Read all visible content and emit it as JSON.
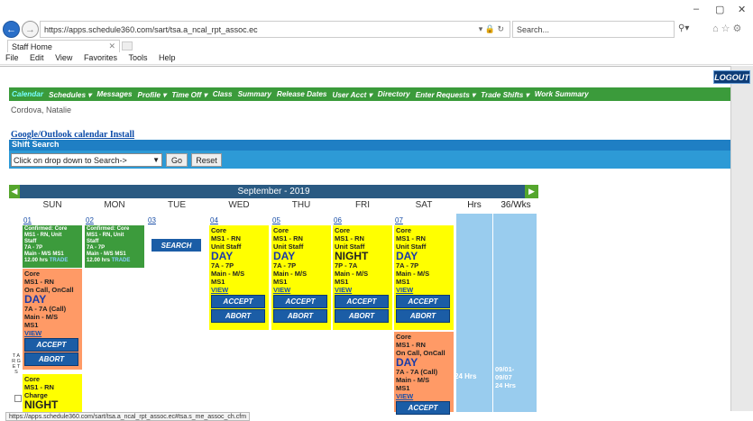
{
  "browser": {
    "url": "https://apps.schedule360.com/sart/tsa.a_ncal_rpt_assoc.ec",
    "search_placeholder": "Search...",
    "tab_title": "Staff Home",
    "menu": [
      "File",
      "Edit",
      "View",
      "Favorites",
      "Tools",
      "Help"
    ],
    "status_url": "https://apps.schedule360.com/sart/tsa.a_ncal_rpt_assoc.ec#tsa.s_me_assoc_ch.cfm",
    "window_controls": [
      "–",
      "▢",
      "✕"
    ]
  },
  "app": {
    "logout_label": "LOGOUT",
    "nav": [
      "Calendar",
      "Schedules ▾",
      "Messages",
      "Profile ▾",
      "Time Off ▾",
      "Class",
      "Summary",
      "Release Dates",
      "User Acct ▾",
      "Directory",
      "Enter Requests ▾",
      "Trade Shifts ▾",
      "Work Summary"
    ],
    "user_name": "Cordova, Natalie",
    "google_link": "Google/Outlook calendar Install",
    "shift_search_title": "Shift Search",
    "dropdown_value": "Click on drop down to Search->",
    "go_label": "Go",
    "reset_label": "Reset",
    "month_title": "September - 2019",
    "search_button": "SEARCH",
    "colors": {
      "nav_green": "#3b9b3b",
      "shift_blue": "#1f7fc4",
      "month_bar": "#2a5a82",
      "card_yellow": "#ffff00",
      "card_orange": "#ff9a66",
      "card_green": "#3c9b3c",
      "hrs_col": "#99ccee"
    }
  },
  "calendar": {
    "day_headers": [
      "SUN",
      "MON",
      "TUE",
      "WED",
      "THU",
      "FRI",
      "SAT",
      "Hrs",
      "36/Wks"
    ],
    "dates": [
      "01",
      "02",
      "03",
      "04",
      "05",
      "06",
      "07"
    ],
    "sun_green": {
      "l1": "Confirmed: Core",
      "l2": "MS1 - RN, Unit",
      "l3": "Staff",
      "l4": "7A - 7P",
      "l5": "Main - M/S MS1",
      "l6": "12.00 hrs",
      "l7": "TRADE"
    },
    "mon_green": {
      "l1": "Confirmed: Core",
      "l2": "MS1 - RN, Unit",
      "l3": "Staff",
      "l4": "7A - 7P",
      "l5": "Main - M/S MS1",
      "l6": "12.00 hrs",
      "l7": "TRADE"
    },
    "sun_orange": {
      "l1": "Core",
      "l2": "MS1 - RN",
      "l3": "On Call, OnCall",
      "l4": "DAY",
      "l5": "7A - 7A (Call)",
      "l6": "Main - M/S",
      "l7": "MS1",
      "view": "VIEW"
    },
    "sun_yellow": {
      "l1": "Core",
      "l2": "MS1 - RN",
      "l3": "Charge",
      "l4": "NIGHT"
    },
    "wed": {
      "l1": "Core",
      "l2": "MS1 - RN",
      "l3": "Unit Staff",
      "l4": "DAY",
      "l5": "7A - 7P",
      "l6": "Main - M/S",
      "l7": "MS1",
      "view": "VIEW"
    },
    "thu": {
      "l1": "Core",
      "l2": "MS1 - RN",
      "l3": "Unit Staff",
      "l4": "DAY",
      "l5": "7A - 7P",
      "l6": "Main - M/S",
      "l7": "MS1",
      "view": "VIEW"
    },
    "fri": {
      "l1": "Core",
      "l2": "MS1 - RN",
      "l3": "Unit Staff",
      "l4": "NIGHT",
      "l5": "7P - 7A",
      "l6": "Main - M/S",
      "l7": "MS1",
      "view": "VIEW"
    },
    "sat": {
      "l1": "Core",
      "l2": "MS1 - RN",
      "l3": "Unit Staff",
      "l4": "DAY",
      "l5": "7A - 7P",
      "l6": "Main - M/S",
      "l7": "MS1",
      "view": "VIEW"
    },
    "sat_orange": {
      "l1": "Core",
      "l2": "MS1 - RN",
      "l3": "On Call, OnCall",
      "l4": "DAY",
      "l5": "7A - 7A (Call)",
      "l6": "Main - M/S",
      "l7": "MS1",
      "view": "VIEW"
    },
    "accept": "ACCEPT",
    "abort": "ABORT",
    "hrs_value": "24 Hrs",
    "wks_l1": "09/01-",
    "wks_l2": "09/07",
    "wks_l3": "24 Hrs",
    "side_label": "T A R G E T S"
  }
}
